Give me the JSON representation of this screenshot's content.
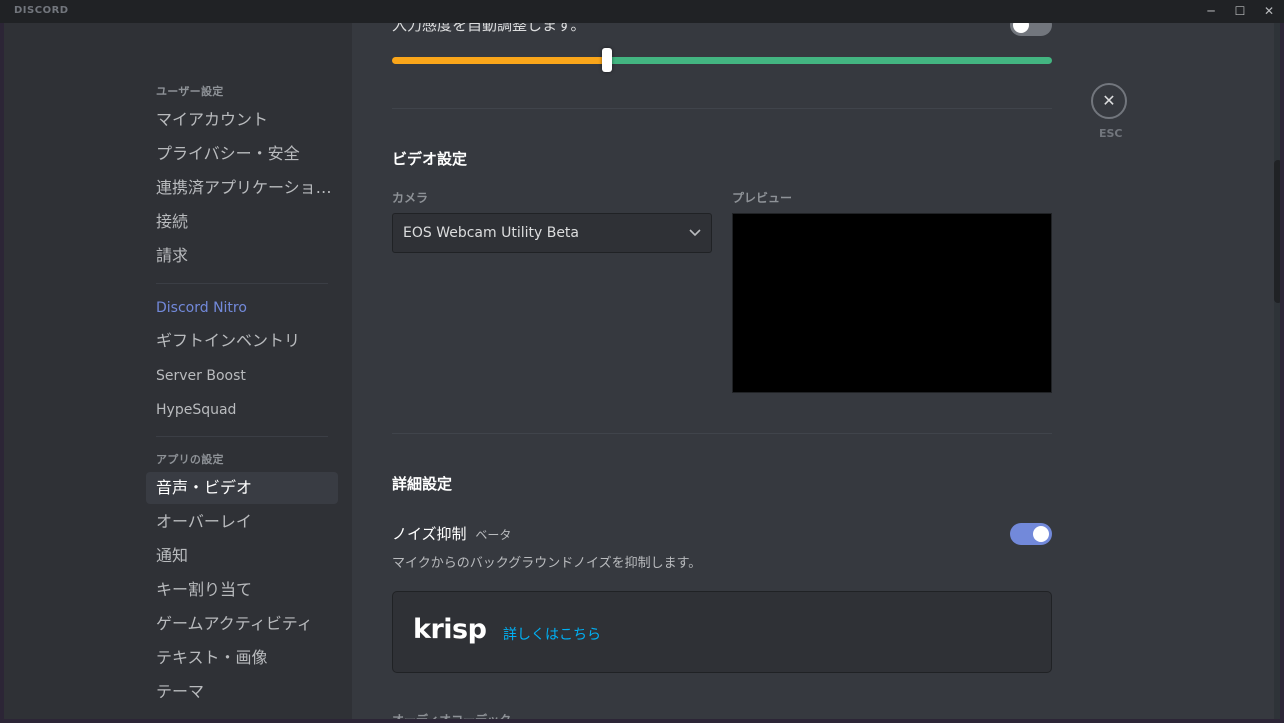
{
  "titlebar": {
    "brand": "DISCORD",
    "min": "─",
    "max": "☐",
    "close": "✕"
  },
  "sidebar": {
    "user_settings_header": "ユーザー設定",
    "user_items": [
      "マイアカウント",
      "プライバシー・安全",
      "連携済アプリケーショ…",
      "接続",
      "請求"
    ],
    "nitro": "Discord Nitro",
    "misc_items": [
      "ギフトインベントリ",
      "Server Boost",
      "HypeSquad"
    ],
    "app_settings_header": "アプリの設定",
    "app_items": [
      "音声・ビデオ",
      "オーバーレイ",
      "通知",
      "キー割り当て",
      "ゲームアクティビティ",
      "テキスト・画像",
      "テーマ"
    ],
    "selected": "音声・ビデオ"
  },
  "content": {
    "partial_top_text": "入力感度を自動調整します。",
    "auto_sensitivity_toggle_on": false,
    "input_sensitivity_level": 0.33,
    "video": {
      "title": "ビデオ設定",
      "camera_label": "カメラ",
      "camera_value": "EOS Webcam Utility Beta",
      "preview_label": "プレビュー"
    },
    "advanced": {
      "title": "詳細設定",
      "noise_title": "ノイズ抑制",
      "noise_badge": "ベータ",
      "noise_desc": "マイクからのバックグラウンドノイズを抑制します。",
      "noise_toggle_on": true,
      "krisp_logo": "krisp",
      "krisp_link": "詳しくはこちら",
      "partial_bottom_text": "オーディオコーデック"
    }
  },
  "close": {
    "icon": "close-icon",
    "glyph": "✕",
    "label": "ESC"
  },
  "colors": {
    "accent": "#7289da",
    "toggle_off": "#72767d",
    "slider_low": "#faa61a",
    "slider_high": "#43b581",
    "link": "#00b0f4"
  }
}
